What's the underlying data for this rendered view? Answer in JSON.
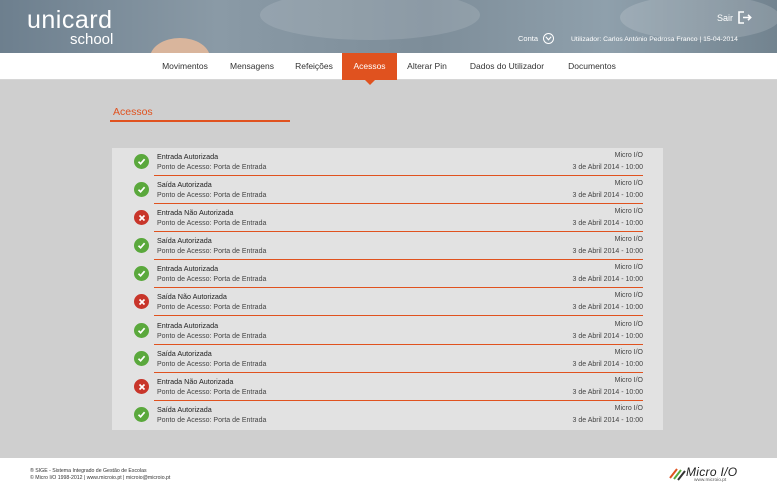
{
  "header": {
    "logo_top": "unicard",
    "logo_bottom": "school",
    "logout_label": "Sair",
    "account_label": "Conta",
    "user_info": "Utilizador: Carlos António Pedrosa Franco | 15-04-2014"
  },
  "nav": {
    "items": [
      {
        "label": "Movimentos"
      },
      {
        "label": "Mensagens"
      },
      {
        "label": "Refeições"
      },
      {
        "label": "Acessos"
      },
      {
        "label": "Alterar Pin"
      },
      {
        "label": "Dados do Utilizador"
      },
      {
        "label": "Documentos"
      }
    ],
    "active": "Acessos"
  },
  "page": {
    "title": "Acessos"
  },
  "accesses": [
    {
      "title": "Entrada Autorizada",
      "point": "Ponto de Acesso: Porta de Entrada",
      "device": "Micro I/O",
      "date": "3 de Abril 2014 - 10:00",
      "status": "ok"
    },
    {
      "title": "Saída Autorizada",
      "point": "Ponto de Acesso: Porta de Entrada",
      "device": "Micro I/O",
      "date": "3 de Abril 2014 - 10:00",
      "status": "ok"
    },
    {
      "title": "Entrada Não Autorizada",
      "point": "Ponto de Acesso: Porta de Entrada",
      "device": "Micro I/O",
      "date": "3 de Abril 2014 - 10:00",
      "status": "fail"
    },
    {
      "title": "Saída Autorizada",
      "point": "Ponto de Acesso: Porta de Entrada",
      "device": "Micro I/O",
      "date": "3 de Abril 2014 - 10:00",
      "status": "ok"
    },
    {
      "title": "Entrada Autorizada",
      "point": "Ponto de Acesso: Porta de Entrada",
      "device": "Micro I/O",
      "date": "3 de Abril 2014 - 10:00",
      "status": "ok"
    },
    {
      "title": "Saída Não Autorizada",
      "point": "Ponto de Acesso: Porta de Entrada",
      "device": "Micro I/O",
      "date": "3 de Abril 2014 - 10:00",
      "status": "fail"
    },
    {
      "title": "Entrada Autorizada",
      "point": "Ponto de Acesso: Porta de Entrada",
      "device": "Micro I/O",
      "date": "3 de Abril 2014 - 10:00",
      "status": "ok"
    },
    {
      "title": "Saída Autorizada",
      "point": "Ponto de Acesso: Porta de Entrada",
      "device": "Micro I/O",
      "date": "3 de Abril 2014 - 10:00",
      "status": "ok"
    },
    {
      "title": "Entrada Não Autorizada",
      "point": "Ponto de Acesso: Porta de Entrada",
      "device": "Micro I/O",
      "date": "3 de Abril 2014 - 10:00",
      "status": "fail"
    },
    {
      "title": "Saída Autorizada",
      "point": "Ponto de Acesso: Porta de Entrada",
      "device": "Micro I/O",
      "date": "3 de Abril 2014 - 10:00",
      "status": "ok"
    }
  ],
  "footer": {
    "line1": "® SIGE - Sistema Integrado de Gestão de Escolas",
    "line2": "© Micro I/O 1998-2012 | www.microio.pt | microio@microio.pt",
    "brand": "Micro I/O",
    "brand_url": "www.microio.pt"
  },
  "colors": {
    "accent": "#e0521f",
    "success": "#5aa83c",
    "error": "#c8352a"
  },
  "icons": {
    "logout": "logout-icon",
    "account": "chevron-down-icon",
    "ok": "check-icon",
    "fail": "cross-icon"
  }
}
